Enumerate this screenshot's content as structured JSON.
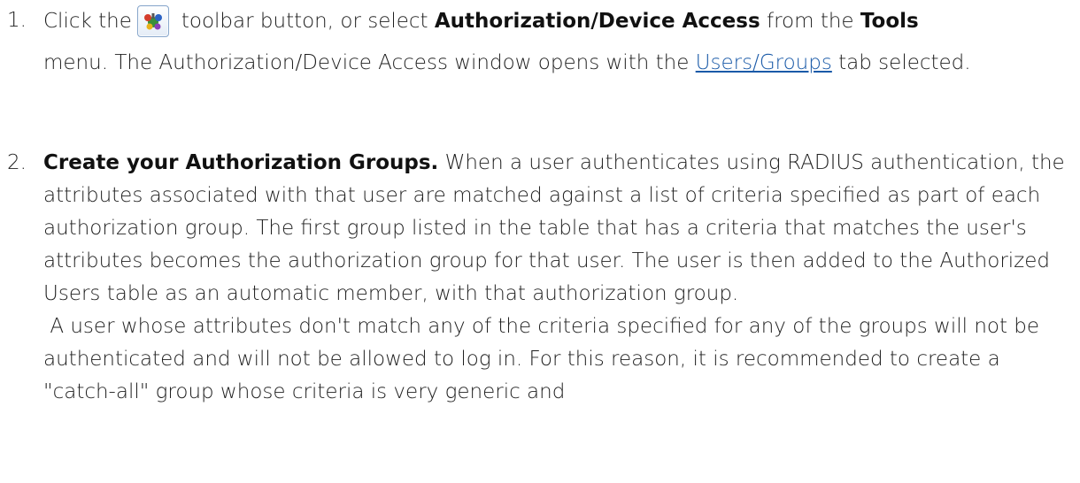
{
  "steps": [
    {
      "number": "1.",
      "text_before_icon": "Click the",
      "toolbar_icon": "authorization-device-access-icon",
      "text_after_icon": "toolbar button, or select",
      "menu_item": "Authorization/Device Access",
      "text_from": "from the",
      "menu_name": "Tools",
      "text_menu_end": "menu. The Authorization/Device Access window opens with the",
      "link_text": "Users/Groups",
      "text_end": "tab selected."
    },
    {
      "number": "2.",
      "heading": "Create your Authorization Groups.",
      "paragraph1": "When a user authenticates using RADIUS authentication, the attributes associated with that user are matched against a list of criteria specified as part of each authorization group. The first group listed in the table that has a criteria that matches the user's attributes becomes the authorization group for that user. The user is then added to the Authorized Users table as an automatic member, with that authorization group.",
      "paragraph2": "A user whose attributes don't match any of the criteria specified for any of the groups will not be authenticated and will not be allowed to log in. For this reason, it is recommended to create a \"catch-all\" group whose criteria is very generic and"
    }
  ]
}
